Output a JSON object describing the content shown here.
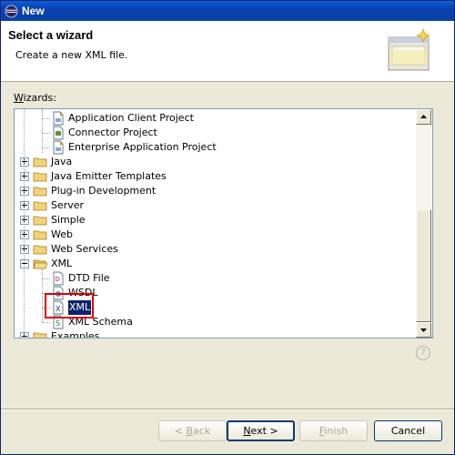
{
  "window": {
    "title": "New"
  },
  "banner": {
    "heading": "Select a wizard",
    "description": "Create a new XML file."
  },
  "wizards_label": {
    "accel": "W",
    "rest": "izards:"
  },
  "tree": [
    {
      "label": "Application Client Project",
      "kind": "file",
      "level": 2,
      "icon": "app-client-icon"
    },
    {
      "label": "Connector Project",
      "kind": "file",
      "level": 2,
      "icon": "connector-icon"
    },
    {
      "label": "Enterprise Application Project",
      "kind": "file",
      "level": 2,
      "icon": "ear-project-icon"
    },
    {
      "label": "Java",
      "kind": "folder",
      "level": 1,
      "expanded": false
    },
    {
      "label": "Java Emitter Templates",
      "kind": "folder",
      "level": 1,
      "expanded": false
    },
    {
      "label": "Plug-in Development",
      "kind": "folder",
      "level": 1,
      "expanded": false
    },
    {
      "label": "Server",
      "kind": "folder",
      "level": 1,
      "expanded": false
    },
    {
      "label": "Simple",
      "kind": "folder",
      "level": 1,
      "expanded": false
    },
    {
      "label": "Web",
      "kind": "folder",
      "level": 1,
      "expanded": false
    },
    {
      "label": "Web Services",
      "kind": "folder",
      "level": 1,
      "expanded": false
    },
    {
      "label": "XML",
      "kind": "folder",
      "level": 1,
      "expanded": true
    },
    {
      "label": "DTD File",
      "kind": "file",
      "level": 2,
      "icon": "dtd-file-icon"
    },
    {
      "label": "WSDL",
      "kind": "file",
      "level": 2,
      "icon": "wsdl-file-icon"
    },
    {
      "label": "XML",
      "kind": "file",
      "level": 2,
      "icon": "xml-file-icon",
      "selected": true
    },
    {
      "label": "XML Schema",
      "kind": "file",
      "level": 2,
      "icon": "xml-schema-icon"
    },
    {
      "label": "Examples",
      "kind": "folder",
      "level": 1,
      "expanded": false
    }
  ],
  "help": {
    "glyph": "?"
  },
  "buttons": {
    "back": {
      "accel": "",
      "pre": "< ",
      "key": "B",
      "post": "ack"
    },
    "next": {
      "pre": "",
      "key": "N",
      "post": "ext >"
    },
    "finish": {
      "pre": "",
      "key": "F",
      "post": "inish"
    },
    "cancel": {
      "label": "Cancel"
    }
  }
}
